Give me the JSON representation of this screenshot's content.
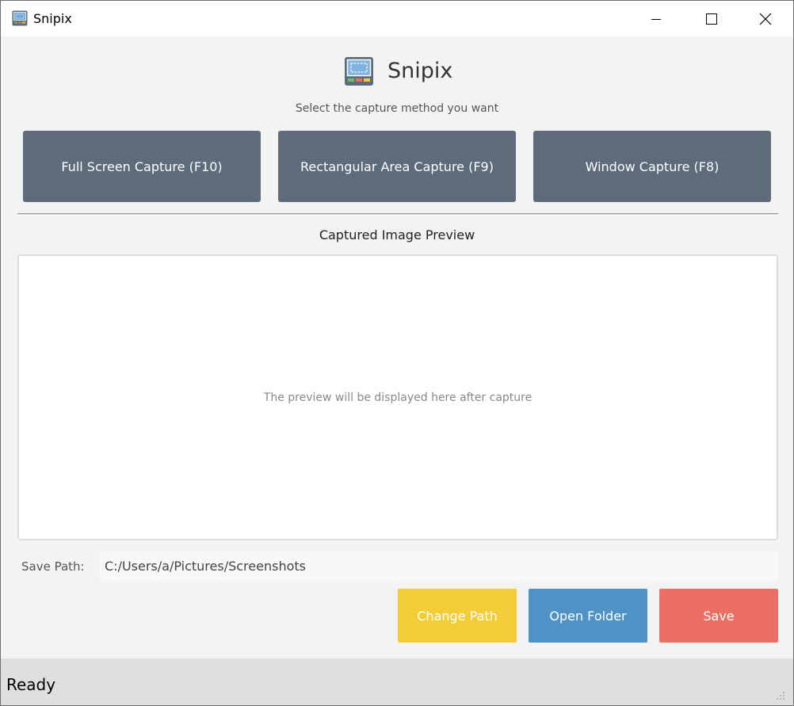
{
  "window": {
    "title": "Snipix",
    "controls": {
      "minimize_icon": "minimize-icon",
      "maximize_icon": "maximize-icon",
      "close_icon": "close-icon"
    }
  },
  "header": {
    "title": "Snipix",
    "subtitle": "Select the capture method you want",
    "logo_icon": "screen-capture-icon"
  },
  "capture_buttons": [
    {
      "label": "Full Screen Capture (F10)"
    },
    {
      "label": "Rectangular Area Capture (F9)"
    },
    {
      "label": "Window Capture (F8)"
    }
  ],
  "preview": {
    "heading": "Captured Image Preview",
    "placeholder": "The preview will be displayed here after capture"
  },
  "save": {
    "label": "Save Path:",
    "path": "C:/Users/a/Pictures/Screenshots"
  },
  "actions": {
    "change_path": "Change Path",
    "open_folder": "Open Folder",
    "save": "Save"
  },
  "status": {
    "text": "Ready"
  },
  "colors": {
    "capture_button": "#5d6b7b",
    "change_path": "#f3cd38",
    "open_folder": "#4f93c6",
    "save": "#eb6f64",
    "status_bar": "#dfdfdf"
  }
}
